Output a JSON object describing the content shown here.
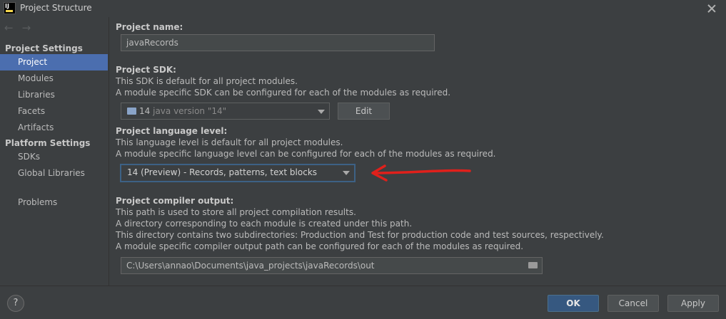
{
  "window": {
    "title": "Project Structure"
  },
  "sidebar": {
    "sections": [
      {
        "header": "Project Settings",
        "items": [
          "Project",
          "Modules",
          "Libraries",
          "Facets",
          "Artifacts"
        ]
      },
      {
        "header": "Platform Settings",
        "items": [
          "SDKs",
          "Global Libraries"
        ]
      }
    ],
    "extra_item": "Problems",
    "selected": "Project"
  },
  "main": {
    "project_name": {
      "label": "Project name:",
      "value": "javaRecords"
    },
    "project_sdk": {
      "label": "Project SDK:",
      "desc1": "This SDK is default for all project modules.",
      "desc2": "A module specific SDK can be configured for each of the modules as required.",
      "sdk_number": "14",
      "sdk_version": "java version \"14\"",
      "edit_label": "Edit"
    },
    "language_level": {
      "label": "Project language level:",
      "desc1": "This language level is default for all project modules.",
      "desc2": "A module specific language level can be configured for each of the modules as required.",
      "value": "14 (Preview) - Records, patterns, text blocks"
    },
    "compiler_output": {
      "label": "Project compiler output:",
      "desc1": "This path is used to store all project compilation results.",
      "desc2": "A directory corresponding to each module is created under this path.",
      "desc3": "This directory contains two subdirectories: Production and Test for production code and test sources, respectively.",
      "desc4": "A module specific compiler output path can be configured for each of the modules as required.",
      "value": "C:\\Users\\annao\\Documents\\java_projects\\javaRecords\\out"
    }
  },
  "footer": {
    "help": "?",
    "ok": "OK",
    "cancel": "Cancel",
    "apply": "Apply"
  },
  "colors": {
    "background": "#3c3f41",
    "selection": "#4b6eaf",
    "primary_button": "#365880",
    "annotation_arrow": "#e0201b"
  },
  "icons": [
    "app-logo-icon",
    "close-icon",
    "back-arrow-icon",
    "forward-arrow-icon",
    "folder-icon",
    "browse-folder-icon",
    "help-icon"
  ]
}
